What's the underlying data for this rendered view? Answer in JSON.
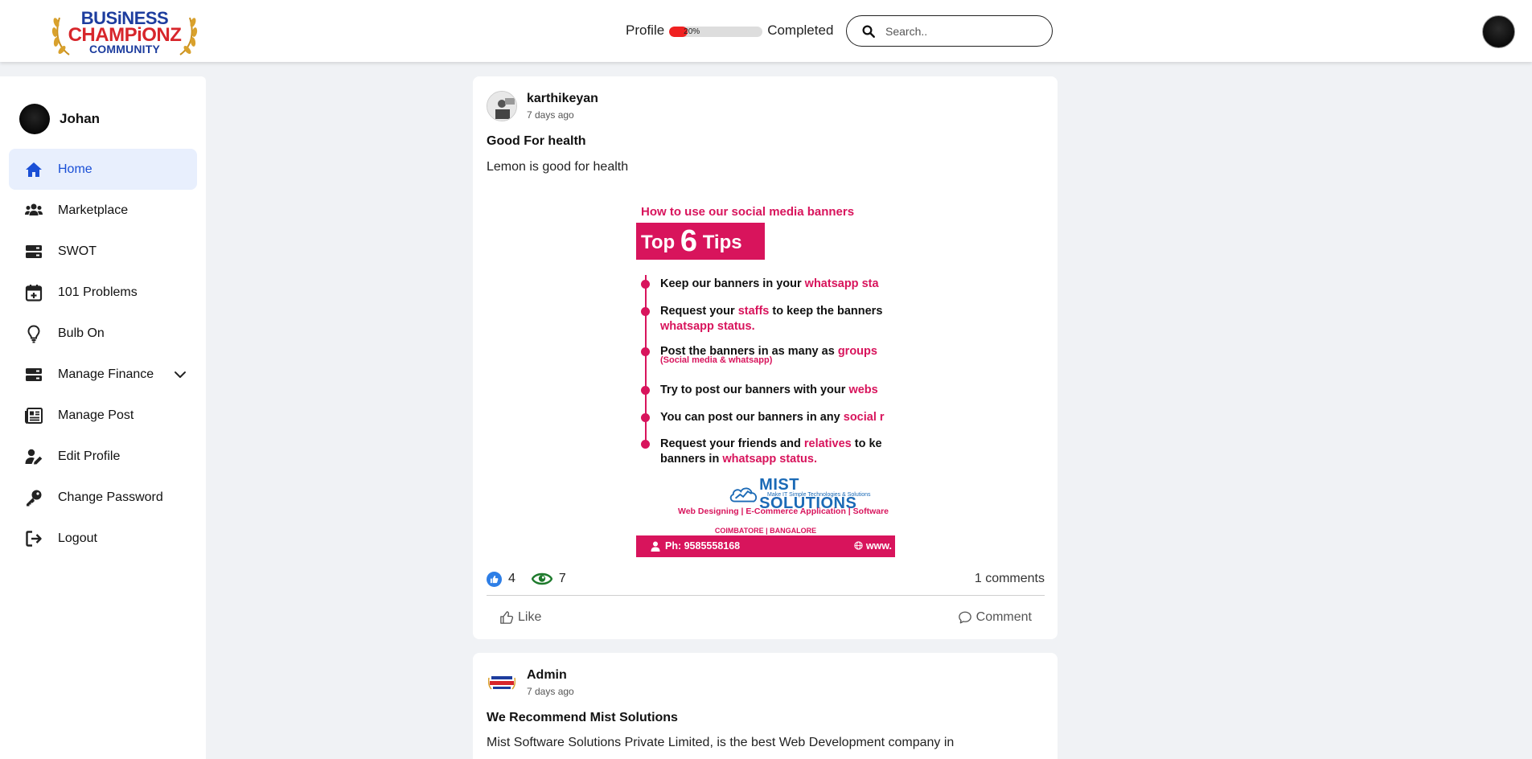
{
  "logo": {
    "line1": "BUSiNESS",
    "line2": "CHAMPiONZ",
    "line3": "COMMUNITY"
  },
  "header": {
    "profile_label": "Profile",
    "progress_text": "20%",
    "progress_value": 0.2,
    "completed_label": "Completed",
    "search_placeholder": "Search.."
  },
  "sidebar": {
    "user_name": "Johan",
    "items": [
      {
        "label": "Home",
        "icon": "home-icon",
        "active": true
      },
      {
        "label": "Marketplace",
        "icon": "users-icon"
      },
      {
        "label": "SWOT",
        "icon": "server-icon"
      },
      {
        "label": "101 Problems",
        "icon": "calendar-plus-icon"
      },
      {
        "label": "Bulb On",
        "icon": "lightbulb-icon"
      },
      {
        "label": "Manage Finance",
        "icon": "server-icon",
        "expandable": true
      },
      {
        "label": "Manage Post",
        "icon": "newspaper-icon"
      },
      {
        "label": "Edit Profile",
        "icon": "user-edit-icon"
      },
      {
        "label": "Change Password",
        "icon": "key-icon"
      },
      {
        "label": "Logout",
        "icon": "logout-icon"
      }
    ]
  },
  "posts": [
    {
      "author": "karthikeyan",
      "time": "7 days ago",
      "title": "Good For health",
      "body": "Lemon is good for health",
      "banner": {
        "heading": "How to use our social media banners",
        "top_text_a": "Top",
        "top_text_b": "6",
        "top_text_c": "Tips",
        "tips": [
          {
            "a": "Keep our banners in your ",
            "b": "whatsapp sta"
          },
          {
            "a": "Request your ",
            "b": "staffs",
            "c": " to keep the banners"
          },
          {
            "a": "",
            "b": "whatsapp status."
          },
          {
            "a": "Post the banners in as many as ",
            "b": "groups"
          },
          {
            "a": "Try to post our banners with your ",
            "b": "webs"
          },
          {
            "a": "You can post our banners in any ",
            "b": "social r"
          },
          {
            "a": "Request your friends and ",
            "b": "relatives",
            "c": " to ke"
          },
          {
            "a": "banners in ",
            "b": "whatsapp status."
          }
        ],
        "sub_note": "(Social media & whatsapp)",
        "company": "MIST SOLUTIONS",
        "company_tag": "Make IT Simple Technologies & Solutions",
        "services": "Web Designing | E-Commerce Application | Software",
        "cities": "COIMBATORE | BANGALORE",
        "phone": "Ph: 9585558168",
        "web": "www."
      },
      "likes": "4",
      "views": "7",
      "comments": "1 comments",
      "like_label": "Like",
      "comment_label": "Comment"
    },
    {
      "author": "Admin",
      "time": "7 days ago",
      "title": "We Recommend Mist Solutions",
      "body": "Mist Software Solutions Private Limited, is the best Web Development company in"
    }
  ],
  "colors": {
    "accent_blue": "#1a4fd6",
    "active_bg": "#e8effd",
    "progress_red": "#f02121",
    "banner_pink": "#d8145c"
  }
}
